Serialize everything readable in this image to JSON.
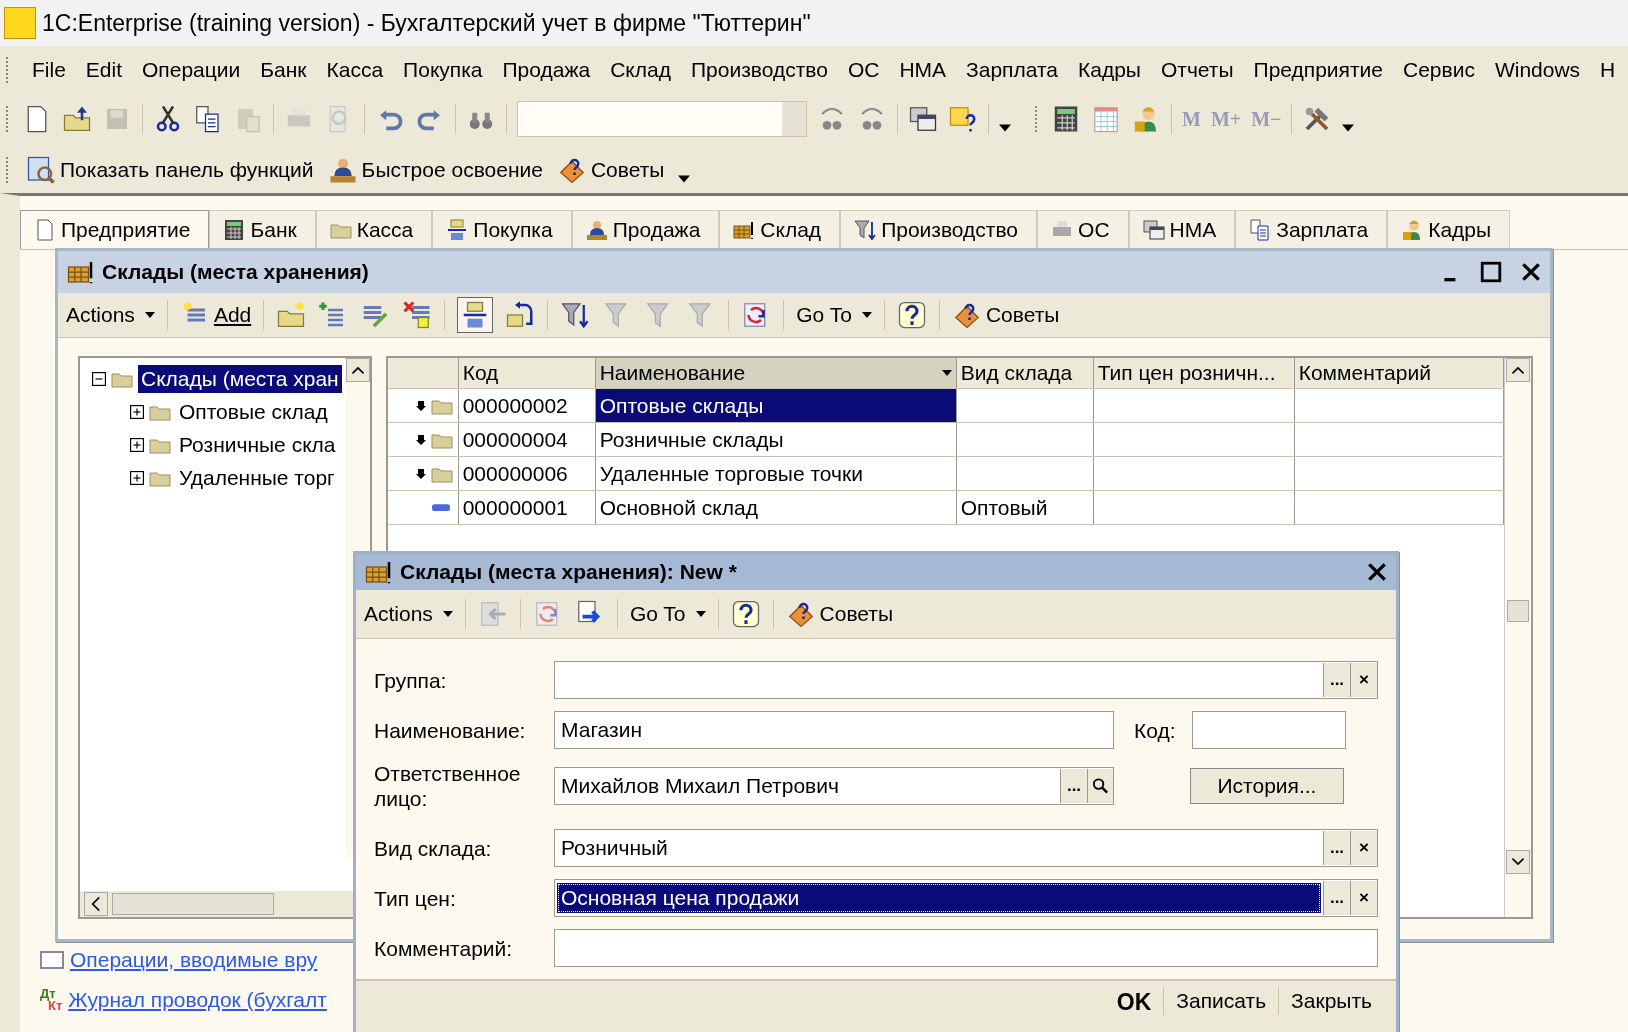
{
  "window": {
    "title": "1C:Enterprise (training version) - Бухгалтерский учет в фирме \"Тюттерин\""
  },
  "menu": [
    {
      "label": "File"
    },
    {
      "label": "Edit"
    },
    {
      "label": "Операции"
    },
    {
      "label": "Банк"
    },
    {
      "label": "Касса"
    },
    {
      "label": "Покупка"
    },
    {
      "label": "Продажа"
    },
    {
      "label": "Склад"
    },
    {
      "label": "Производство"
    },
    {
      "label": "ОС"
    },
    {
      "label": "НМА"
    },
    {
      "label": "Зарплата"
    },
    {
      "label": "Кадры"
    },
    {
      "label": "Отчеты"
    },
    {
      "label": "Предприятие"
    },
    {
      "label": "Сервис"
    },
    {
      "label": "Windows"
    },
    {
      "label": "Н"
    }
  ],
  "memory_buttons": [
    {
      "label": "M",
      "disabled": true
    },
    {
      "label": "M+",
      "disabled": true
    },
    {
      "label": "M−",
      "disabled": true
    }
  ],
  "function_bar": [
    {
      "label": "Показать панель функций"
    },
    {
      "label": "Быстрое освоение"
    },
    {
      "label": "Советы"
    }
  ],
  "section_tabs": [
    {
      "label": "Предприятие",
      "selected": true
    },
    {
      "label": "Банк",
      "selected": false
    },
    {
      "label": "Касса",
      "selected": false
    },
    {
      "label": "Покупка",
      "selected": false
    },
    {
      "label": "Продажа",
      "selected": false
    },
    {
      "label": "Склад",
      "selected": false
    },
    {
      "label": "Производство",
      "selected": false
    },
    {
      "label": "ОС",
      "selected": false
    },
    {
      "label": "НМА",
      "selected": false
    },
    {
      "label": "Зарплата",
      "selected": false
    },
    {
      "label": "Кадры",
      "selected": false
    }
  ],
  "background_links": [
    {
      "label": "Операции, вводимые вру"
    },
    {
      "label": "Журнал проводок (бухгалт",
      "badge": [
        "Дт",
        "Кт"
      ]
    }
  ],
  "list_window": {
    "title": "Склады (места хранения)",
    "actions_menu": "Actions",
    "add_button": "Add",
    "goto_menu": "Go To",
    "tips_button": "Советы",
    "tree": [
      {
        "label": "Склады (места хран",
        "selected": true,
        "expanded": true,
        "children": [
          {
            "label": "Оптовые склад",
            "selected": false,
            "expanded": false
          },
          {
            "label": "Розничные скла",
            "selected": false,
            "expanded": false
          },
          {
            "label": "Удаленные торг",
            "selected": false,
            "expanded": false
          }
        ]
      }
    ],
    "table": {
      "columns": [
        "Код",
        "Наименование",
        "Вид склада",
        "Тип цен розничн...",
        "Комментарий"
      ],
      "rows": [
        {
          "kind": "group",
          "selected": true,
          "cells": [
            "000000002",
            "Оптовые склады",
            "",
            "",
            ""
          ]
        },
        {
          "kind": "group",
          "selected": false,
          "cells": [
            "000000004",
            "Розничные склады",
            "",
            "",
            ""
          ]
        },
        {
          "kind": "group",
          "selected": false,
          "cells": [
            "000000006",
            "Удаленные торговые точки",
            "",
            "",
            ""
          ]
        },
        {
          "kind": "item",
          "selected": false,
          "cells": [
            "000000001",
            "Основной склад",
            "Оптовый",
            "",
            ""
          ]
        }
      ]
    }
  },
  "form_window": {
    "title": "Склады (места хранения): New *",
    "actions_menu": "Actions",
    "goto_menu": "Go To",
    "tips_button": "Советы",
    "fields": [
      {
        "kind": "ref",
        "label": "Группа:",
        "selected": false,
        "buttons": [
          "...",
          "×"
        ]
      },
      {
        "kind": "name",
        "label": "Наименование:",
        "value": "Магазин",
        "code_label": "Код:"
      },
      {
        "kind": "person",
        "label": "Ответственное лицо:",
        "value": "Михайлов Михаил Петрович",
        "buttons": [
          "..."
        ],
        "history_button": "История..."
      },
      {
        "kind": "ref",
        "label": "Вид склада:",
        "value": "Розничный",
        "selected": false,
        "buttons": [
          "...",
          "×"
        ]
      },
      {
        "kind": "ref",
        "label": "Тип цен:",
        "value": "Основная цена продажи",
        "selected": true,
        "buttons": [
          "...",
          "×"
        ]
      },
      {
        "kind": "text",
        "label": "Комментарий:"
      }
    ],
    "footer_buttons": [
      {
        "label": "OK",
        "default": true
      },
      {
        "label": "Записать",
        "default": false
      },
      {
        "label": "Закрыть",
        "default": false
      }
    ]
  }
}
